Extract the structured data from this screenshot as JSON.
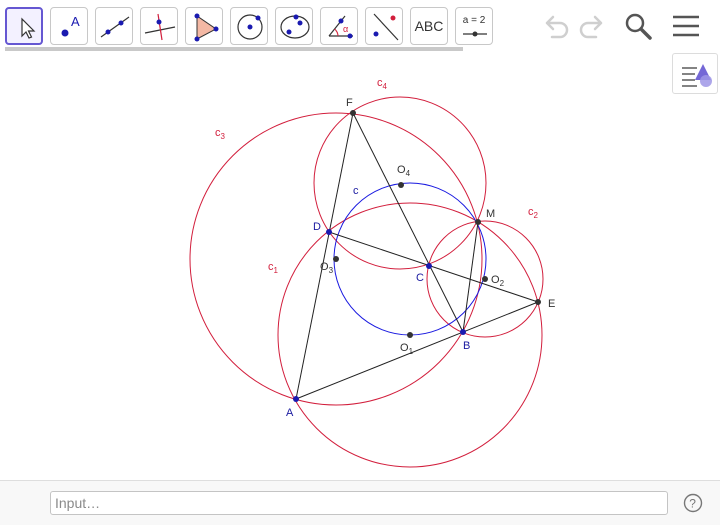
{
  "toolbar": {
    "tools": [
      {
        "id": "move",
        "label": ""
      },
      {
        "id": "point",
        "label": "A"
      },
      {
        "id": "line",
        "label": ""
      },
      {
        "id": "perpendicular",
        "label": ""
      },
      {
        "id": "polygon",
        "label": ""
      },
      {
        "id": "circle-center",
        "label": ""
      },
      {
        "id": "circle-three-points",
        "label": ""
      },
      {
        "id": "angle",
        "label": "α"
      },
      {
        "id": "reflect",
        "label": ""
      },
      {
        "id": "text",
        "label": "ABC"
      },
      {
        "id": "slider",
        "label": "a = 2"
      }
    ]
  },
  "input": {
    "placeholder": "Input…"
  },
  "labels": {
    "F": "F",
    "D": "D",
    "C": "C",
    "M": "M",
    "E": "E",
    "B": "B",
    "A": "A",
    "O4": "O",
    "O4_sub": "4",
    "O3": "O",
    "O3_sub": "3",
    "O2": "O",
    "O2_sub": "2",
    "O1": "O",
    "O1_sub": "1",
    "c": "c",
    "c1": "c",
    "c1_sub": "1",
    "c2": "c",
    "c2_sub": "2",
    "c3": "c",
    "c3_sub": "3",
    "c4": "c",
    "c4_sub": "4"
  },
  "colors": {
    "accent": "#6557d2",
    "circle_red": "#d21e3c",
    "circle_blue": "#1a1ae0",
    "point_blue": "#1a1ab0",
    "point_dark": "#333333"
  }
}
